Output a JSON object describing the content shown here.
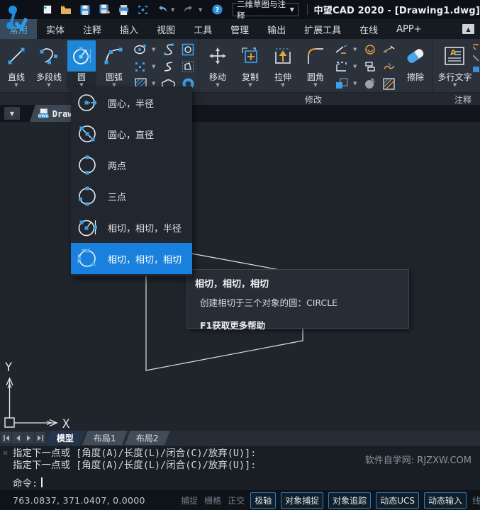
{
  "titlebar": {
    "workspace_selector": "二维草图与注释",
    "title": "中望CAD 2020 - [Drawing1.dwg]",
    "qat_icons": [
      "new-file-icon",
      "open-folder-icon",
      "save-icon",
      "save-as-icon",
      "print-icon",
      "select-window-icon",
      "undo-icon",
      "redo-icon",
      "help-icon"
    ]
  },
  "ribbon_tabs": {
    "items": [
      {
        "label": "常用",
        "active": true
      },
      {
        "label": "实体",
        "active": false
      },
      {
        "label": "注释",
        "active": false
      },
      {
        "label": "插入",
        "active": false
      },
      {
        "label": "视图",
        "active": false
      },
      {
        "label": "工具",
        "active": false
      },
      {
        "label": "管理",
        "active": false
      },
      {
        "label": "输出",
        "active": false
      },
      {
        "label": "扩展工具",
        "active": false
      },
      {
        "label": "在线",
        "active": false
      },
      {
        "label": "APP+",
        "active": false
      }
    ]
  },
  "ribbon": {
    "draw": {
      "tools": [
        {
          "label": "直线",
          "active": false
        },
        {
          "label": "多段线",
          "active": false
        },
        {
          "label": "圆",
          "active": true
        },
        {
          "label": "圆弧",
          "active": false
        }
      ],
      "small_icons": [
        "ellipse-icon",
        "spline-icon",
        "rectangle-icon",
        "points-icon",
        "spline-edit-icon",
        "polygon-icon",
        "hatch-icon",
        "revision-cloud-icon",
        "donut-icon"
      ]
    },
    "modify": {
      "panel_label": "修改",
      "tools": [
        {
          "label": "移动"
        },
        {
          "label": "复制"
        },
        {
          "label": "拉伸"
        },
        {
          "label": "圆角"
        },
        {
          "label": "擦除"
        }
      ],
      "small_icons": [
        "trim-icon",
        "extend-icon",
        "match-properties-icon",
        "rectangle-array-icon",
        "offset-icon",
        "break-icon",
        "scale-icon",
        "explode-icon",
        "edit-hatch-icon"
      ]
    },
    "annotate": {
      "panel_label": "注释",
      "tools": [
        {
          "label": "多行文字"
        }
      ]
    }
  },
  "document_tab": {
    "label": "Drawi",
    "file_icon": "dwg-file-icon"
  },
  "circle_menu": {
    "items": [
      {
        "label": "圆心，半径",
        "active": false
      },
      {
        "label": "圆心，直径",
        "active": false
      },
      {
        "label": "两点",
        "active": false
      },
      {
        "label": "三点",
        "active": false
      },
      {
        "label": "相切，相切，半径",
        "active": false
      },
      {
        "label": "相切，相切，相切",
        "active": true
      }
    ]
  },
  "tooltip": {
    "title": "相切，相切，相切",
    "body": "创建相切于三个对象的圆：CIRCLE",
    "footer": "F1获取更多帮助"
  },
  "canvas": {
    "x_axis_label": "X",
    "y_axis_label": "Y"
  },
  "layout_tabs": {
    "items": [
      {
        "label": "模型",
        "active": true
      },
      {
        "label": "布局1",
        "active": false
      },
      {
        "label": "布局2",
        "active": false
      }
    ]
  },
  "command": {
    "lines": [
      "指定下一点或 [角度(A)/长度(L)/闭合(C)/放弃(U)]:",
      "指定下一点或 [角度(A)/长度(L)/闭合(C)/放弃(U)]:"
    ],
    "prompt": "命令:",
    "watermark": "软件自学网: RJZXW.COM"
  },
  "statusbar": {
    "coordinates": "763.0837, 371.0407, 0.0000",
    "toggles": [
      {
        "label": "捕捉",
        "active": false
      },
      {
        "label": "栅格",
        "active": false
      },
      {
        "label": "正交",
        "active": false
      },
      {
        "label": "极轴",
        "active": true
      },
      {
        "label": "对象捕捉",
        "active": true
      },
      {
        "label": "对象追踪",
        "active": true
      },
      {
        "label": "动态UCS",
        "active": true
      },
      {
        "label": "动态输入",
        "active": true
      },
      {
        "label": "线宽",
        "active": false
      }
    ]
  },
  "colors": {
    "accent_blue": "#1e87d7",
    "menu_highlight": "#1a80dd",
    "icon_blue": "#3aa0e8",
    "icon_orange": "#e8a33d",
    "canvas_bg": "#20252c"
  }
}
